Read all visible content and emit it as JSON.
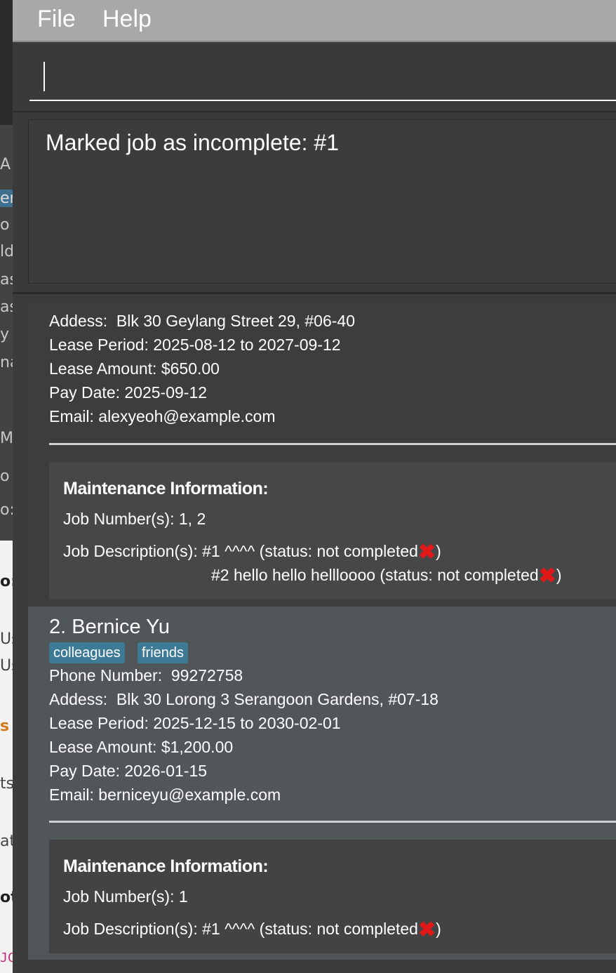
{
  "menubar": {
    "file": "File",
    "help": "Help"
  },
  "command_box": {
    "value": ""
  },
  "result_display": {
    "text": "Marked job as incomplete: #1"
  },
  "background_window": {
    "fragments": [
      "A",
      "er",
      "o",
      "ld",
      "as",
      "as",
      "y",
      "na",
      "M",
      "o",
      "o",
      "o:",
      "Us",
      "Us",
      "s",
      "ts",
      "at:",
      "ot",
      "JC"
    ]
  },
  "persons": [
    {
      "address_label": "Addess:",
      "address": "Blk 30 Geylang Street 29, #06-40",
      "lease_period": "Lease Period: 2025-08-12 to 2027-09-12",
      "lease_amount": "Lease Amount: $650.00",
      "pay_date": "Pay Date: 2025-09-12",
      "email": "Email: alexyeoh@example.com",
      "maintenance": {
        "title": "Maintenance Information:",
        "job_numbers": "Job Number(s): 1, 2",
        "desc_label": "Job Description(s):",
        "jobs": [
          {
            "text": "#1 ^^^^ (status: not completed",
            "close": ")"
          },
          {
            "text": "#2 hello hello hellloooo (status: not completed",
            "close": ")"
          }
        ]
      }
    },
    {
      "name": "2.  Bernice Yu",
      "tags": [
        "colleagues",
        "friends"
      ],
      "phone_label": "Phone Number:",
      "phone": "99272758",
      "address_label": "Addess:",
      "address": "Blk 30 Lorong 3 Serangoon Gardens, #07-18",
      "lease_period": "Lease Period: 2025-12-15 to 2030-02-01",
      "lease_amount": "Lease Amount: $1,200.00",
      "pay_date": "Pay Date: 2026-01-15",
      "email": "Email: berniceyu@example.com",
      "maintenance": {
        "title": "Maintenance Information:",
        "job_numbers": "Job Number(s): 1",
        "desc_label": "Job Description(s):",
        "jobs": [
          {
            "text": "#1 ^^^^ (status: not completed",
            "close": ")"
          }
        ]
      }
    }
  ],
  "status_icon": "cross-mark-icon",
  "colors": {
    "tag": "#3d7a96",
    "cross": "#e01818",
    "selected_card": "#515659"
  }
}
